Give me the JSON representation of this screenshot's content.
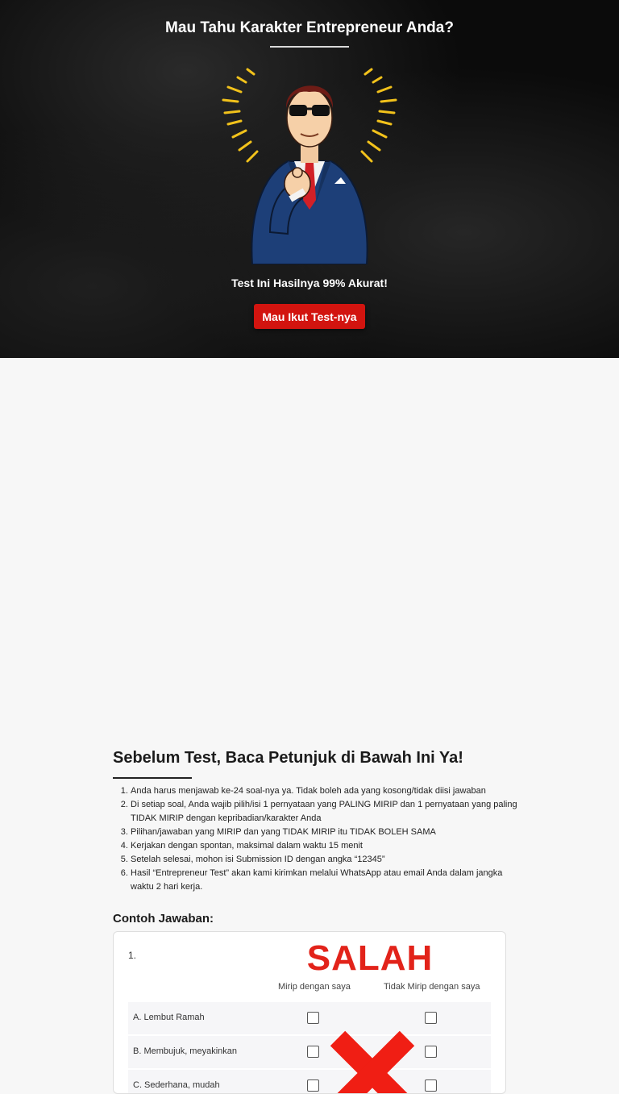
{
  "hero": {
    "title": "Mau Tahu Karakter Entrepreneur Anda?",
    "tagline": "Test Ini Hasilnya 99% Akurat!",
    "cta_label": "Mau Ikut Test-nya",
    "illustration_icon": "pointing-businessman-icon"
  },
  "instructions": {
    "title": "Sebelum Test, Baca Petunjuk di Bawah Ini Ya!",
    "items": [
      "Anda harus menjawab ke-24 soal-nya ya. Tidak boleh ada yang kosong/tidak diisi jawaban",
      "Di setiap soal, Anda wajib pilih/isi 1 pernyataan yang PALING MIRIP dan 1 pernyataan yang paling TIDAK MIRIP dengan kepribadian/karakter Anda",
      "Pilihan/jawaban yang MIRIP dan yang TIDAK MIRIP itu TIDAK BOLEH SAMA",
      "Kerjakan dengan spontan, maksimal dalam waktu 15 menit",
      "Setelah selesai, mohon isi Submission ID dengan angka “12345”",
      "Hasil “Entrepreneur Test” akan kami kirimkan melalui WhatsApp atau email Anda dalam jangka waktu 2 hari kerja."
    ]
  },
  "examples": {
    "title": "Contoh Jawaban:",
    "question_number": "1.",
    "verdict": "SALAH",
    "col_similar": "Mirip dengan saya",
    "col_not_similar": "Tidak Mirip dengan saya",
    "options": [
      "A. Lembut Ramah",
      "B. Membujuk, meyakinkan",
      "C. Sederhana, mudah"
    ]
  },
  "colors": {
    "accent_red": "#d2140f",
    "verdict_red": "#e2231a"
  }
}
